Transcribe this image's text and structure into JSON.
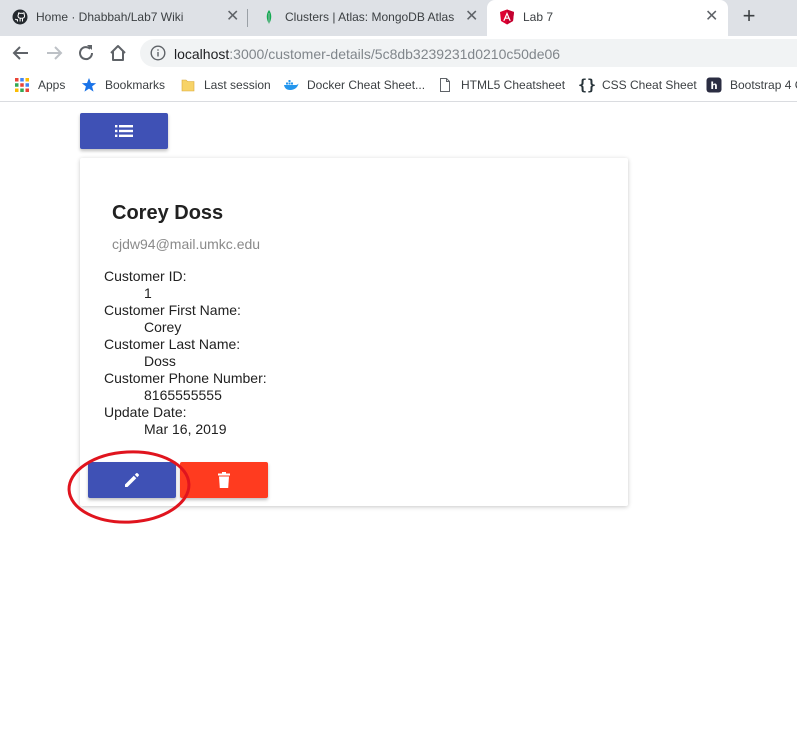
{
  "browser": {
    "tabs": [
      {
        "title": "Home · Dhabbah/Lab7 Wiki",
        "icon": "github-icon"
      },
      {
        "title": "Clusters | Atlas: MongoDB Atlas",
        "icon": "mongodb-leaf-icon"
      },
      {
        "title": "Lab 7",
        "icon": "angular-icon",
        "active": true
      }
    ],
    "url_host": "localhost",
    "url_rest": ":3000/customer-details/5c8db3239231d0210c50de06",
    "bookmarks": [
      {
        "label": "Apps",
        "icon": "apps-grid-icon"
      },
      {
        "label": "Bookmarks",
        "icon": "star-icon"
      },
      {
        "label": "Last session",
        "icon": "folder-icon"
      },
      {
        "label": "Docker Cheat Sheet...",
        "icon": "docker-icon"
      },
      {
        "label": "HTML5 Cheatsheet",
        "icon": "page-icon"
      },
      {
        "label": "CSS Cheat Sheet",
        "icon": "braces-icon"
      },
      {
        "label": "Bootstrap 4 C",
        "icon": "bootstrap-icon"
      }
    ]
  },
  "customer": {
    "name": "Corey Doss",
    "email": "cjdw94@mail.umkc.edu",
    "fields": [
      {
        "label": "Customer ID:",
        "value": "1"
      },
      {
        "label": "Customer First Name:",
        "value": "Corey"
      },
      {
        "label": "Customer Last Name:",
        "value": "Doss"
      },
      {
        "label": "Customer Phone Number:",
        "value": "8165555555"
      },
      {
        "label": "Update Date:",
        "value": "Mar 16, 2019"
      }
    ]
  },
  "colors": {
    "primary": "#3f51b5",
    "warn": "#ff3b1f",
    "annotation": "#e0141e"
  }
}
